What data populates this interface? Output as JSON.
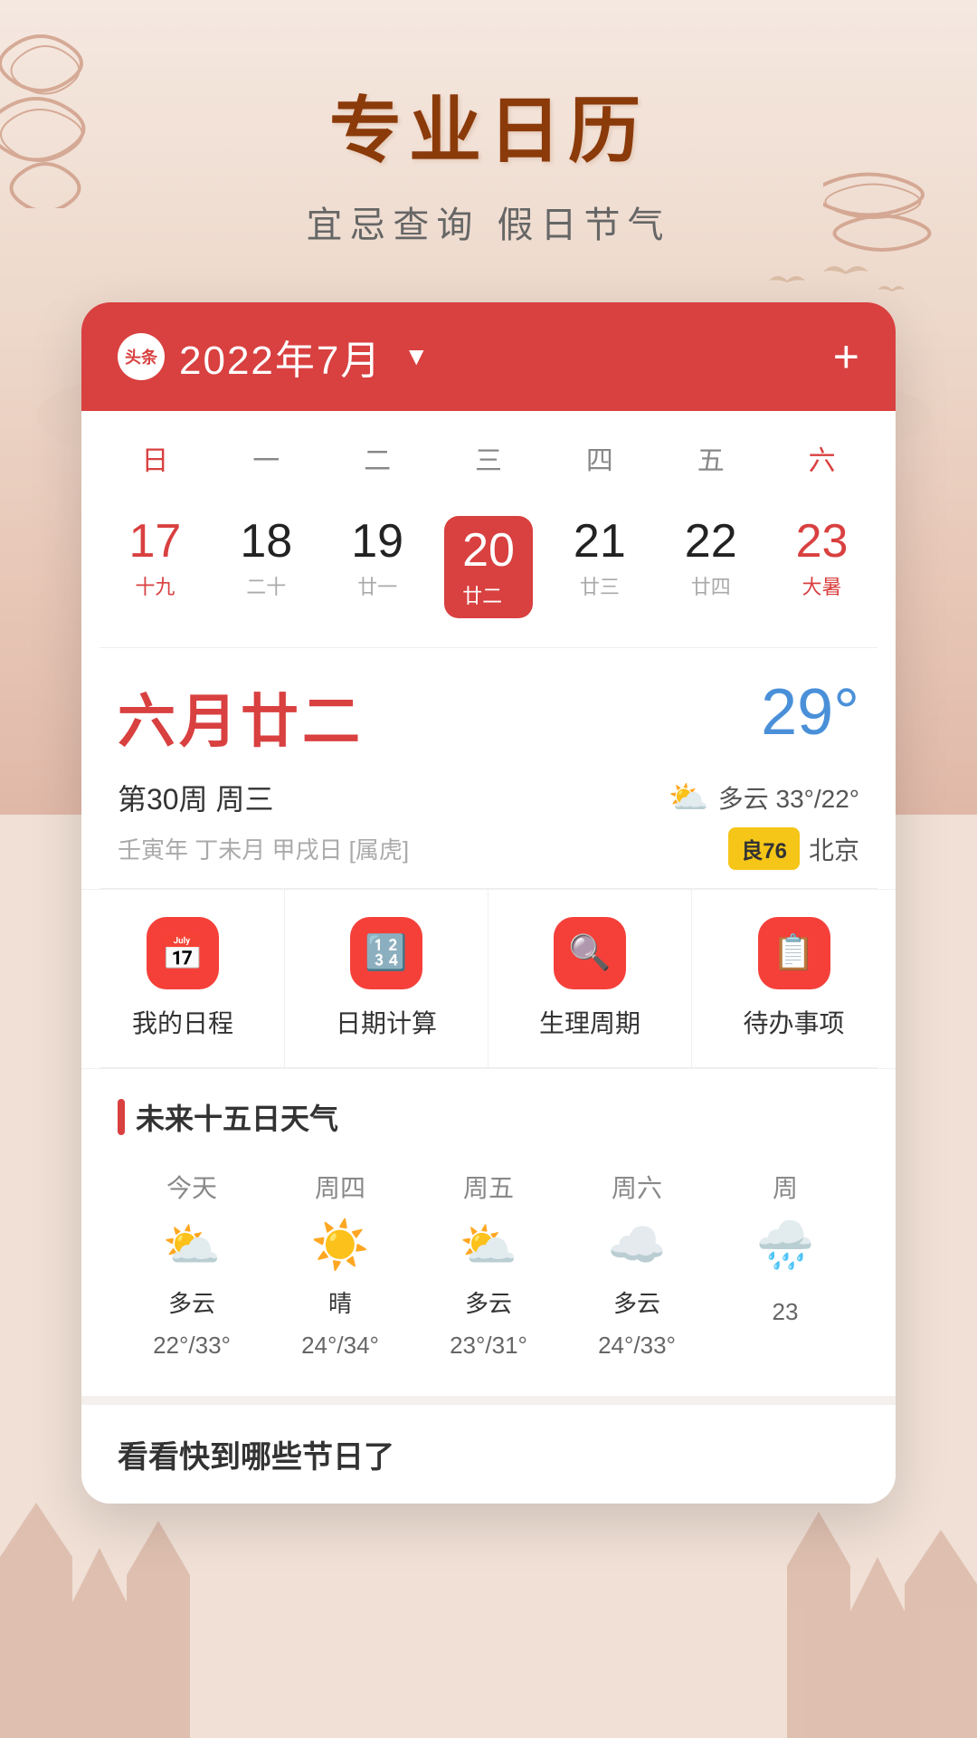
{
  "app": {
    "title": "专业日历",
    "subtitle": "宜忌查询 假日节气"
  },
  "calendar": {
    "header": {
      "logo_text": "头条",
      "month_label": "2022年7月",
      "add_icon": "+",
      "dropdown_symbol": "▼"
    },
    "week_days": [
      "日",
      "一",
      "二",
      "三",
      "四",
      "五",
      "六"
    ],
    "dates": [
      {
        "num": "17",
        "lunar": "十九",
        "is_red": true,
        "is_today": false
      },
      {
        "num": "18",
        "lunar": "二十",
        "is_red": false,
        "is_today": false
      },
      {
        "num": "19",
        "lunar": "廿一",
        "is_red": false,
        "is_today": false
      },
      {
        "num": "20",
        "lunar": "廿二",
        "is_red": false,
        "is_today": true
      },
      {
        "num": "21",
        "lunar": "廿三",
        "is_red": false,
        "is_today": false
      },
      {
        "num": "22",
        "lunar": "廿四",
        "is_red": false,
        "is_today": false
      },
      {
        "num": "23",
        "lunar": "大暑",
        "is_red": true,
        "is_today": false
      }
    ],
    "lunar_date": "六月廿二",
    "temperature": "29°",
    "week_detail": "第30周  周三",
    "weather_current": "多云 33°/22°",
    "ganzhi": "壬寅年 丁未月 甲戌日 [属虎]",
    "aqi": "良76",
    "city": "北京",
    "functions": [
      {
        "label": "我的日程",
        "icon": "📅"
      },
      {
        "label": "日期计算",
        "icon": "🔢"
      },
      {
        "label": "生理周期",
        "icon": "🔍"
      },
      {
        "label": "待办事项",
        "icon": "📋"
      }
    ]
  },
  "weather_forecast": {
    "section_title": "未来十五日天气",
    "days": [
      {
        "label": "今天",
        "icon": "⛅",
        "desc": "多云",
        "temp": "22°/33°"
      },
      {
        "label": "周四",
        "icon": "☀️",
        "desc": "晴",
        "temp": "24°/34°"
      },
      {
        "label": "周五",
        "icon": "⛅",
        "desc": "多云",
        "temp": "23°/31°"
      },
      {
        "label": "周六",
        "icon": "☁️",
        "desc": "多云",
        "temp": "24°/33°"
      },
      {
        "label": "周",
        "icon": "🌧️",
        "desc": "",
        "temp": "23"
      }
    ]
  },
  "bottom": {
    "title": "看看快到哪些节日了"
  },
  "colors": {
    "primary_red": "#d94040",
    "accent_blue": "#4a90d9",
    "bg_warm": "#f0e0d6",
    "text_dark": "#333333",
    "text_gray": "#888888"
  }
}
